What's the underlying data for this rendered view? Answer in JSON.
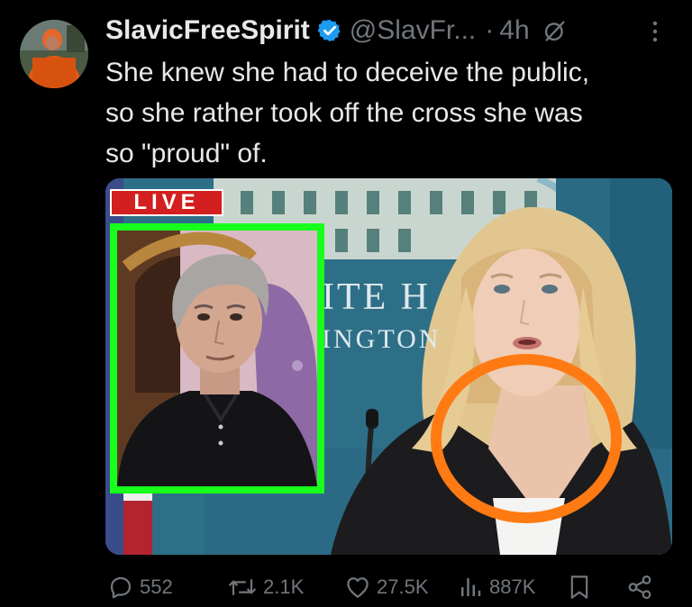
{
  "tweet": {
    "display_name": "SlavicFreeSpirit",
    "handle": "@SlavFr...",
    "separator": "·",
    "time": "4h",
    "text": "She knew she had to deceive the public,\nso she rather took off the cross she was\nso \"proud\" of.",
    "icons": {
      "verified": "verified-badge-icon",
      "grok": "grok-icon",
      "more": "more-options-icon"
    }
  },
  "media": {
    "live_badge": "LIVE",
    "wall_text_line1": "ITE H",
    "wall_text_line2": "INGTON",
    "colors": {
      "inset_border": "#19ff1c",
      "circle_annotation": "#ff7a12",
      "live_badge": "#d31f1f"
    }
  },
  "actions": {
    "replies": "552",
    "reposts": "2.1K",
    "likes": "27.5K",
    "views": "887K",
    "icons": [
      "reply-icon",
      "repost-icon",
      "like-icon",
      "views-icon",
      "bookmark-icon",
      "share-icon"
    ]
  },
  "colors": {
    "background": "#000000",
    "text": "#e7e9ea",
    "muted": "#71767b",
    "verified": "#1d9bf0"
  }
}
